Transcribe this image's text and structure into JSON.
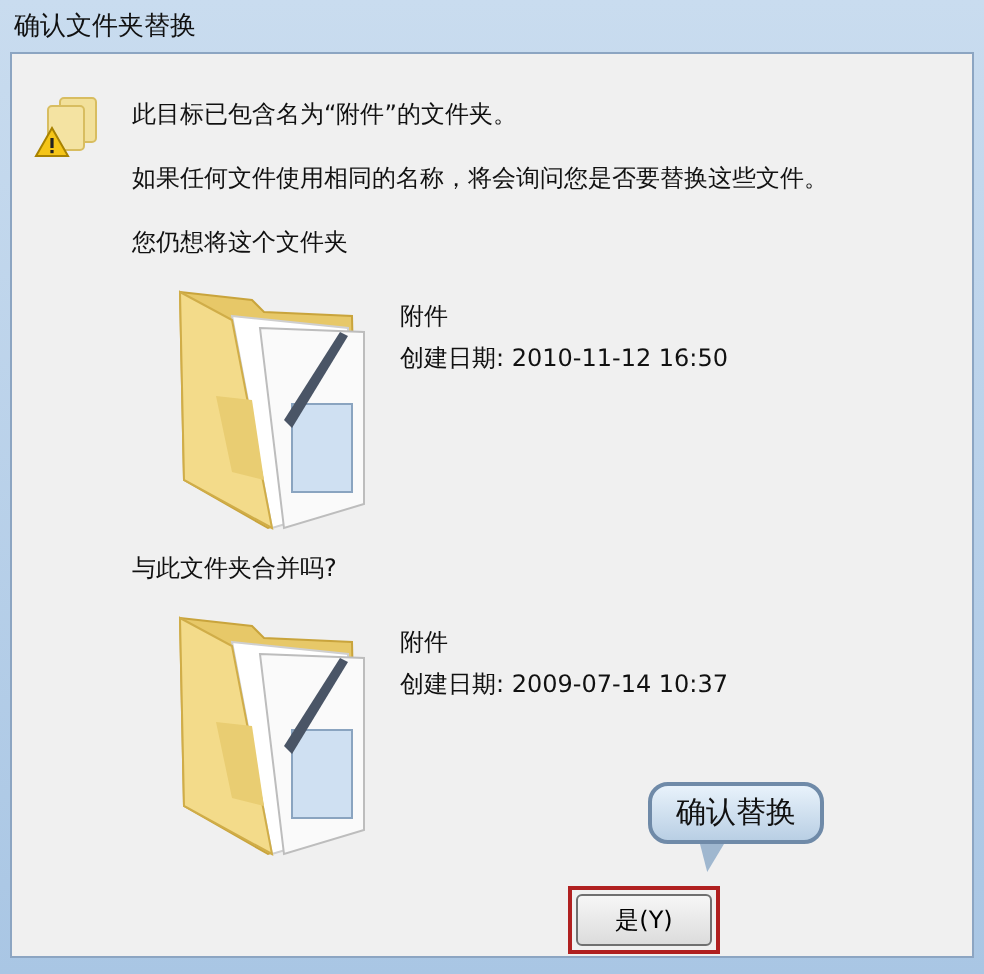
{
  "window": {
    "title": "确认文件夹替换"
  },
  "message": "此目标已包含名为“附件”的文件夹。",
  "detail": "如果任何文件使用相同的名称，将会询问您是否要替换这些文件。",
  "question": "您仍想将这个文件夹",
  "folders": [
    {
      "name": "附件",
      "created": "创建日期: 2010-11-12 16:50"
    },
    {
      "name": "附件",
      "created": "创建日期: 2009-07-14 10:37"
    }
  ],
  "merge_question": "与此文件夹合并吗?",
  "callout": {
    "text": "确认替换"
  },
  "buttons": [
    {
      "label": "是(Y)",
      "highlighted": true
    }
  ]
}
